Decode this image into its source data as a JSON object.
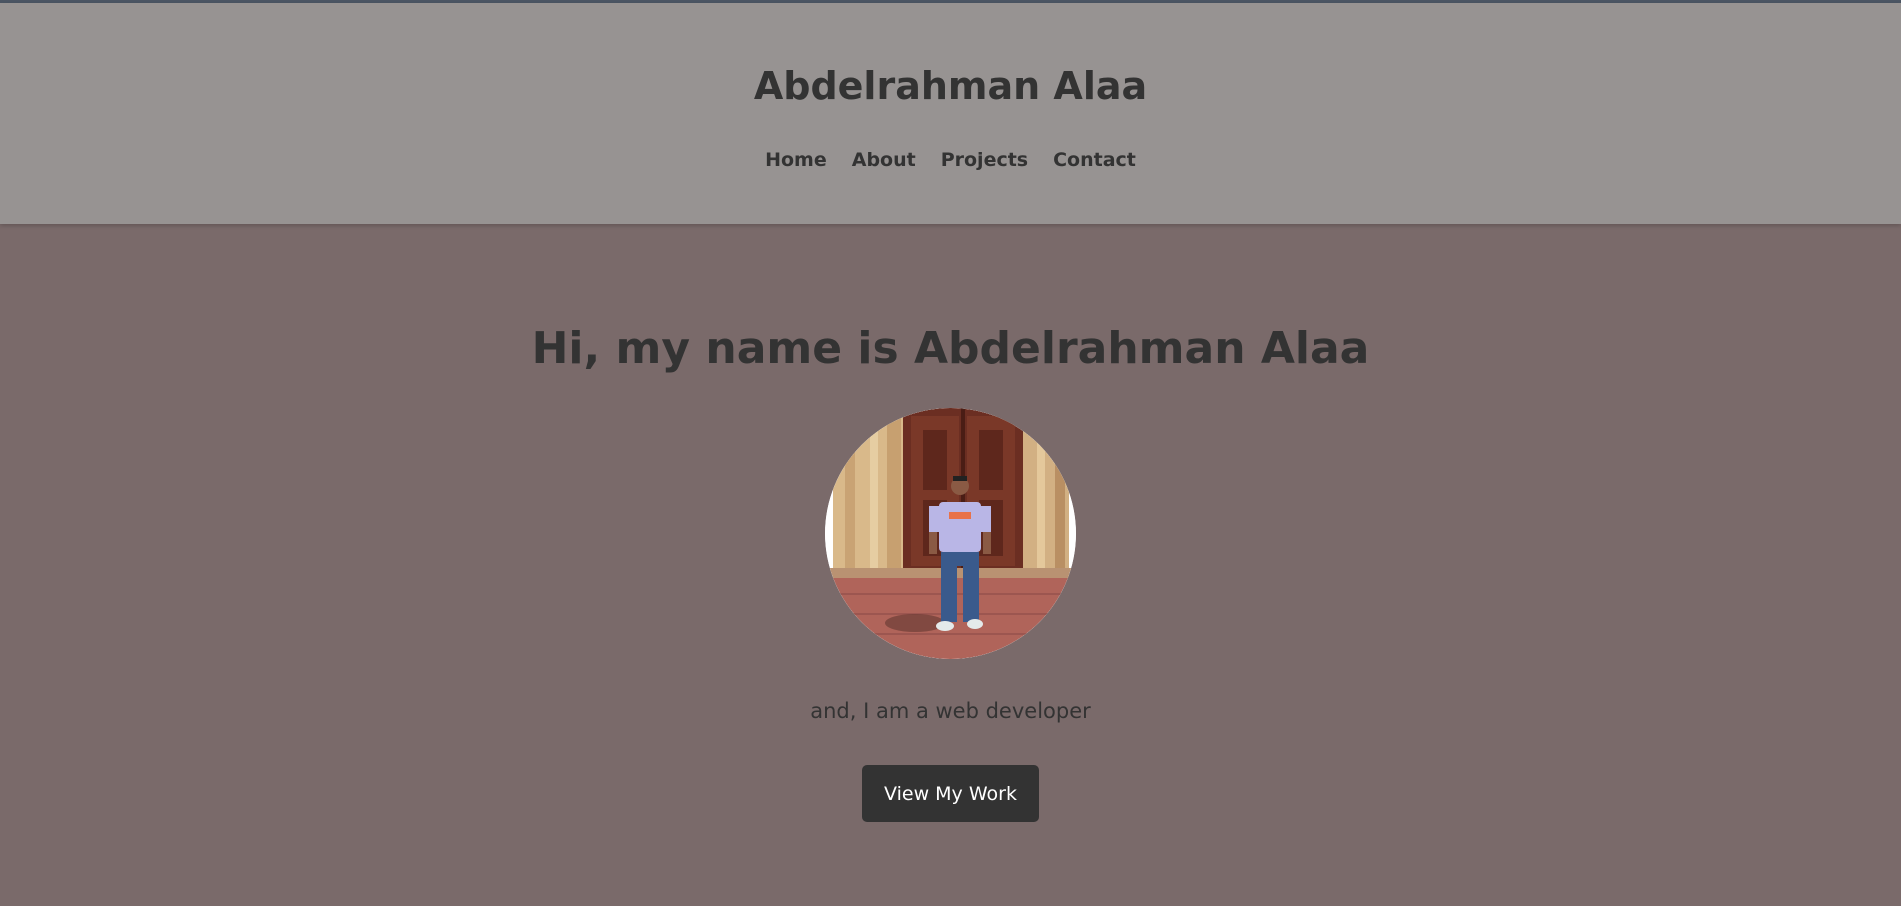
{
  "header": {
    "site_title": "Abdelrahman Alaa",
    "nav": [
      {
        "label": "Home"
      },
      {
        "label": "About"
      },
      {
        "label": "Projects"
      },
      {
        "label": "Contact"
      }
    ]
  },
  "hero": {
    "heading": "Hi, my name is Abdelrahman Alaa",
    "tagline": "and, I am a web developer",
    "cta_label": "View My Work"
  },
  "colors": {
    "page_background": "#7a6a6a",
    "header_background": "#979392",
    "text": "#333333",
    "button_background": "#333333",
    "button_text": "#ffffff"
  }
}
